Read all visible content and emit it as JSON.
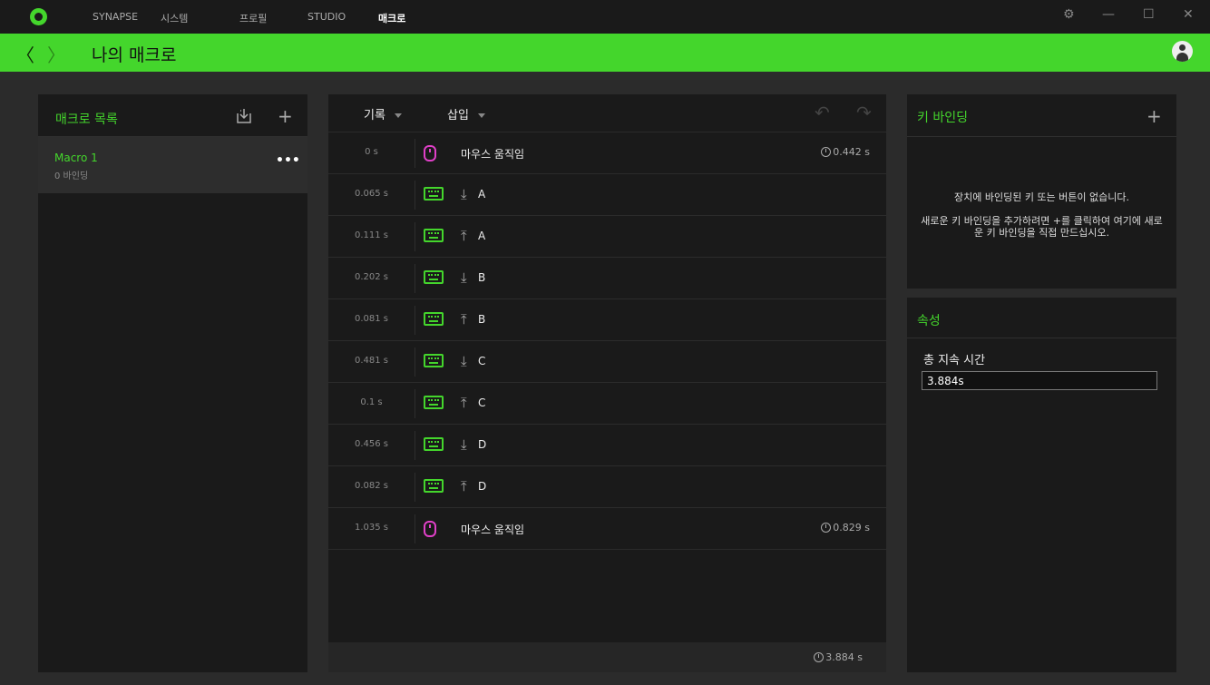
{
  "titlebar": {
    "nav": [
      "SYNAPSE",
      "시스템",
      "프로필",
      "STUDIO",
      "매크로"
    ],
    "active_index": 4,
    "controls": {
      "settings": "⚙",
      "minimize": "—",
      "maximize": "☐",
      "close": "✕"
    }
  },
  "header": {
    "back": "〈",
    "forward": "〉",
    "title": "나의 매크로"
  },
  "macro_list": {
    "title": "매크로 목록",
    "items": [
      {
        "name": "Macro 1",
        "bindings": "0 바인딩",
        "more": "•••"
      }
    ]
  },
  "editor": {
    "record_label": "기록",
    "insert_label": "삽입",
    "undo": "↶",
    "redo": "↷",
    "rows": [
      {
        "time": "0 s",
        "type": "mouse",
        "label": "마우스 움직임",
        "duration": "0.442 s"
      },
      {
        "time": "0.065 s",
        "type": "key",
        "direction": "down",
        "key": "A"
      },
      {
        "time": "0.111 s",
        "type": "key",
        "direction": "up",
        "key": "A"
      },
      {
        "time": "0.202 s",
        "type": "key",
        "direction": "down",
        "key": "B"
      },
      {
        "time": "0.081 s",
        "type": "key",
        "direction": "up",
        "key": "B"
      },
      {
        "time": "0.481 s",
        "type": "key",
        "direction": "down",
        "key": "C"
      },
      {
        "time": "0.1 s",
        "type": "key",
        "direction": "up",
        "key": "C"
      },
      {
        "time": "0.456 s",
        "type": "key",
        "direction": "down",
        "key": "D"
      },
      {
        "time": "0.082 s",
        "type": "key",
        "direction": "up",
        "key": "D"
      },
      {
        "time": "1.035 s",
        "type": "mouse",
        "label": "마우스 움직임",
        "duration": "0.829 s"
      }
    ],
    "total": "3.884 s"
  },
  "key_binding": {
    "title": "키 바인딩",
    "empty_line1": "장치에 바인딩된 키 또는 버튼이 없습니다.",
    "empty_line2a": "새로운 키 바인딩을 추가하려면 +를 클릭하여 여기에 새로",
    "empty_line2b": "운 키 바인딩을 직접 만드십시오."
  },
  "properties": {
    "title": "속성",
    "duration_label": "총 지속 시간",
    "duration_value": "3.884s"
  },
  "colors": {
    "accent": "#44d62c",
    "mouse": "#e040c8",
    "panel": "#1a1a1a",
    "background": "#2b2b2b"
  }
}
